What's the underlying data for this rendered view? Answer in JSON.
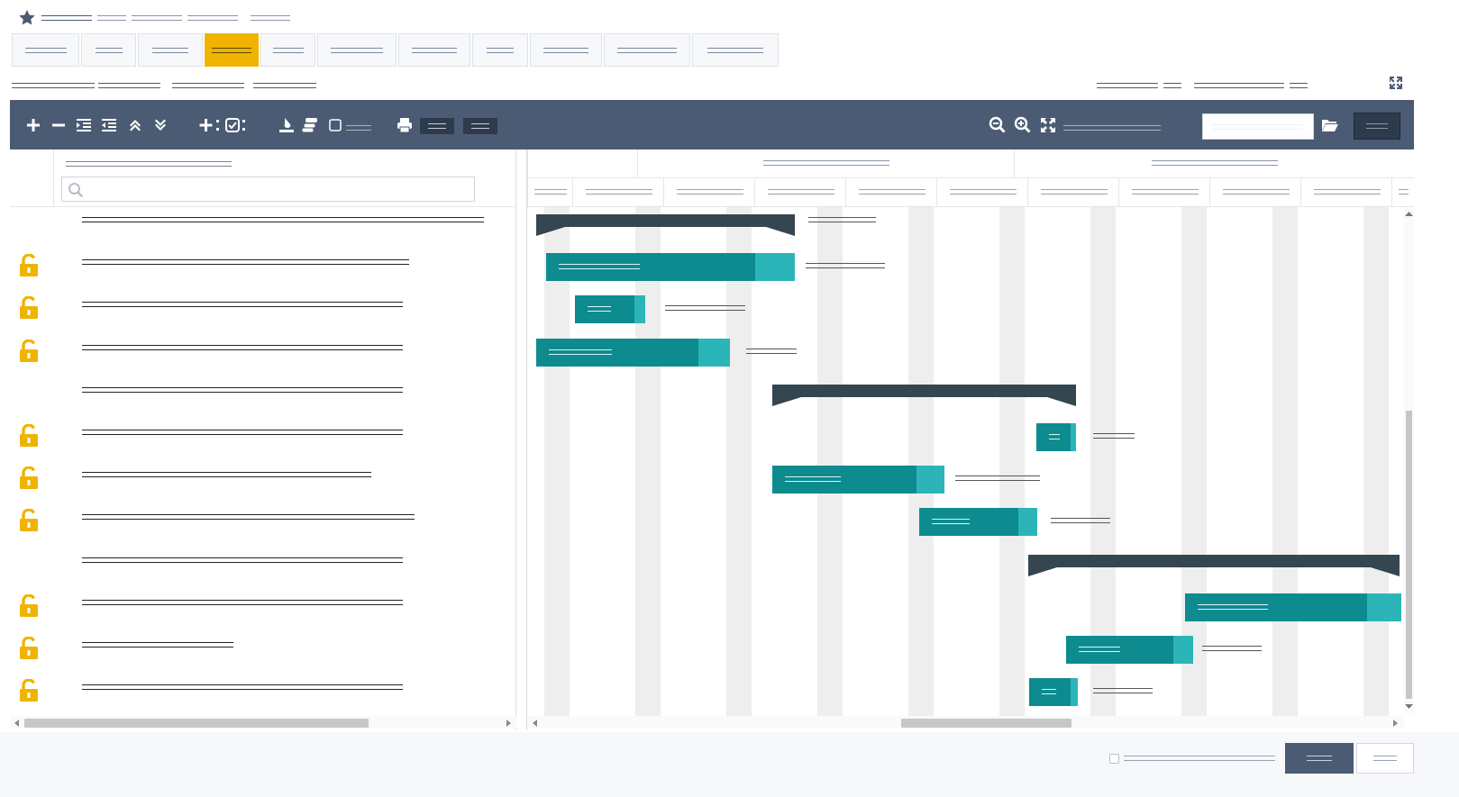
{
  "page": {
    "crumb": [
      "",
      "",
      "",
      "",
      ""
    ],
    "tabs": [
      "",
      "",
      "",
      "",
      "",
      "",
      "",
      "",
      "",
      "",
      ""
    ],
    "active_tab": 3
  },
  "subbar": {
    "left": [
      "",
      "",
      ""
    ],
    "right": [
      "",
      "",
      "",
      ""
    ]
  },
  "toolbar": {
    "tools": [
      "plus-icon",
      "minus-icon",
      "indent-icon",
      "outdent-icon",
      "expand-up-icon",
      "expand-down-icon",
      "add-column-icon",
      "checkbox-column-icon",
      "fill-icon",
      "layers-icon",
      "checkbox-icon",
      "print-icon",
      "zoom-out-icon",
      "zoom-in-icon",
      "fit-icon",
      "folder-open-icon"
    ],
    "checkbox_label": "",
    "btn1": "",
    "btn2": "",
    "zoom_label": "",
    "search_placeholder": "",
    "action_button": ""
  },
  "grid": {
    "column_header": "",
    "filter_placeholder": "",
    "rows": [
      {
        "name": "",
        "locked": false,
        "summary": true
      },
      {
        "name": "",
        "locked": true,
        "summary": false
      },
      {
        "name": "",
        "locked": true,
        "summary": false
      },
      {
        "name": "",
        "locked": true,
        "summary": false
      },
      {
        "name": "",
        "locked": false,
        "summary": true
      },
      {
        "name": "",
        "locked": true,
        "summary": false
      },
      {
        "name": "",
        "locked": true,
        "summary": false
      },
      {
        "name": "",
        "locked": true,
        "summary": false
      },
      {
        "name": "",
        "locked": false,
        "summary": true
      },
      {
        "name": "",
        "locked": true,
        "summary": false
      },
      {
        "name": "",
        "locked": true,
        "summary": false
      },
      {
        "name": "",
        "locked": true,
        "summary": false
      }
    ]
  },
  "timeline": {
    "top_headers": [
      "",
      "",
      ""
    ],
    "bottom_headers": [
      "",
      "",
      "",
      "",
      "",
      "",
      "",
      "",
      "",
      "",
      ""
    ]
  },
  "footer": {
    "checkbox_label": "",
    "primary_button": "",
    "secondary_button": ""
  },
  "colors": {
    "toolbar": "#4b5b73",
    "accent": "#f0b400",
    "task": "#0e8b8f",
    "progress": "#2bb5b8",
    "summary": "#344650"
  }
}
